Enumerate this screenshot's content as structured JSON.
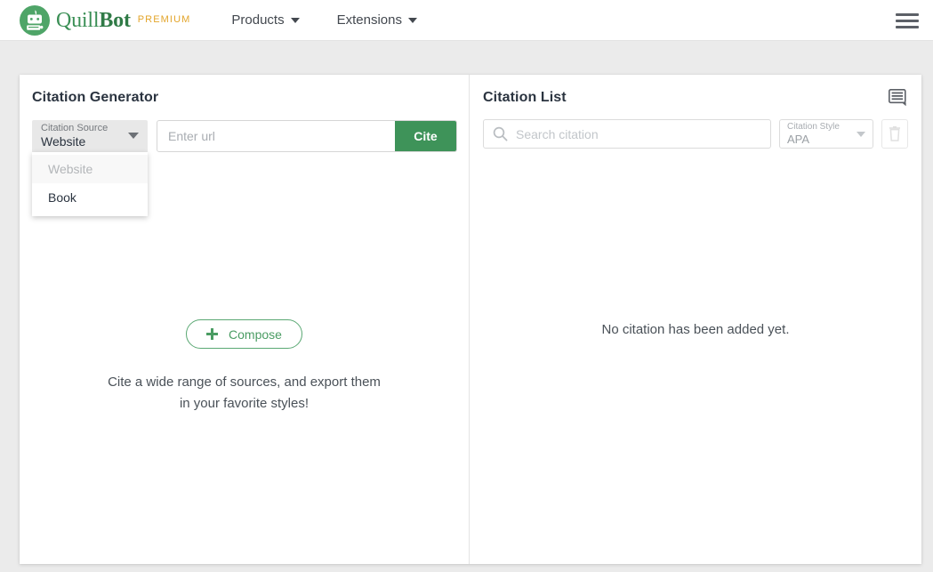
{
  "nav": {
    "brand": {
      "logo_icon": "quillbot-robot-logo-icon",
      "name_part1": "Quill",
      "name_part2": "Bot",
      "badge": "PREMIUM"
    },
    "items": [
      {
        "label": "Products",
        "icon": "chevron-down-icon"
      },
      {
        "label": "Extensions",
        "icon": "chevron-down-icon"
      }
    ],
    "menu_icon": "hamburger-menu-icon"
  },
  "generator": {
    "title": "Citation Generator",
    "source_select": {
      "label": "Citation Source",
      "value": "Website",
      "caret_icon": "chevron-down-icon",
      "options": [
        {
          "label": "Website",
          "selected": true
        },
        {
          "label": "Book",
          "selected": false
        }
      ]
    },
    "url_input": {
      "placeholder": "Enter url",
      "value": ""
    },
    "cite_button": "Cite",
    "empty": {
      "compose_button": "Compose",
      "compose_icon": "plus-icon",
      "subtitle": "Cite a wide range of sources, and export them in your favorite styles!"
    }
  },
  "citation_list": {
    "title": "Citation List",
    "notes_icon": "notes-list-icon",
    "search": {
      "placeholder": "Search citation",
      "value": "",
      "icon": "search-icon"
    },
    "style_select": {
      "label": "Citation Style",
      "value": "APA",
      "caret_icon": "chevron-down-icon"
    },
    "delete_button_icon": "trash-icon",
    "empty_text": "No citation has been added yet."
  },
  "colors": {
    "brand_green": "#3a8f55",
    "cite_green": "#3e9359",
    "premium_gold": "#e3a52b",
    "page_bg": "#ebebeb"
  }
}
